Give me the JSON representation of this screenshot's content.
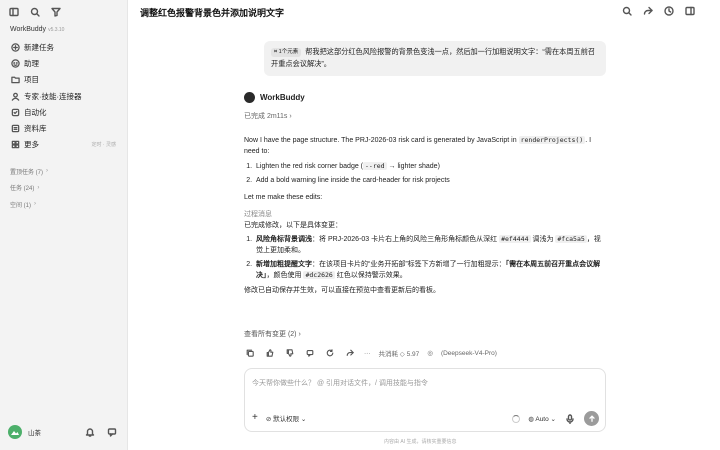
{
  "app": {
    "name": "WorkBuddy",
    "version": "v5.3.10"
  },
  "sidebar": {
    "items": [
      {
        "label": "新建任务",
        "icon": "plus-circle-icon"
      },
      {
        "label": "助理",
        "icon": "assistant-icon"
      },
      {
        "label": "项目",
        "icon": "folder-icon"
      },
      {
        "label": "专家·技能·连接器",
        "icon": "skills-icon"
      },
      {
        "label": "自动化",
        "icon": "automation-icon"
      },
      {
        "label": "资料库",
        "icon": "library-icon"
      },
      {
        "label": "更多",
        "icon": "more-icon",
        "hint": "定时 · 灵感"
      }
    ],
    "groups": [
      {
        "label": "置顶任务 (7)"
      },
      {
        "label": "任务 (24)"
      },
      {
        "label": "空间 (1)"
      }
    ],
    "user": {
      "name": "山茶"
    }
  },
  "header": {
    "title": "调整红色报警背景色并添加说明文字"
  },
  "user_message": {
    "chip": "1个元素",
    "text": "帮我把这部分红色风险报警的背景色变浅一点，然后加一行加粗说明文字：“需在本周五前召开重点会议解决”。"
  },
  "assistant": {
    "name": "WorkBuddy",
    "done": "已完成 2m11s",
    "intro_a": "Now I have the page structure. The PRJ-2026-03 risk card is generated by JavaScript in",
    "intro_code": "renderProjects()",
    "intro_b": ". I need to:",
    "step1_a": "Lighten the red risk corner badge (",
    "step1_code": "--red",
    "step1_b": " → lighter shade)",
    "step2": "Add a bold warning line inside the card-header for risk projects",
    "let_me": "Let me make these edits:",
    "process": "过程消息",
    "summary_title": "已完成修改，以下是具体变更：",
    "c1_title": "风险角标背景调浅",
    "c1_a": "：将 PRJ-2026-03 卡片右上角的风险三角形角标颜色从深红 ",
    "c1_code1": "#ef4444",
    "c1_b": " 调浅为 ",
    "c1_code2": "#fca5a5",
    "c1_c": "，视觉上更加柔和。",
    "c2_title": "新增加粗提醒文字",
    "c2_a": "：在该项目卡片的“业务开拓部”标签下方新增了一行加粗提示：",
    "c2_bold": "「需在本周五前召开重点会议解决」",
    "c2_b": "，颜色使用 ",
    "c2_code": "#dc2626",
    "c2_c": " 红色以保持警示效果。",
    "closing": "修改已自动保存并生效，可以直接在预览中查看更新后的看板。",
    "changes": "查看所有变更 (2)",
    "usage": "共消耗 ◇ 5.97",
    "model": "(Deepseek-V4-Pro)"
  },
  "composer": {
    "placeholder": "今天帮你做些什么？ @ 引用对话文件，/ 调用技能与指令",
    "permission": "默认权限",
    "mode": "Auto"
  },
  "footer": "内容由 AI 生成，请核实重要信息"
}
